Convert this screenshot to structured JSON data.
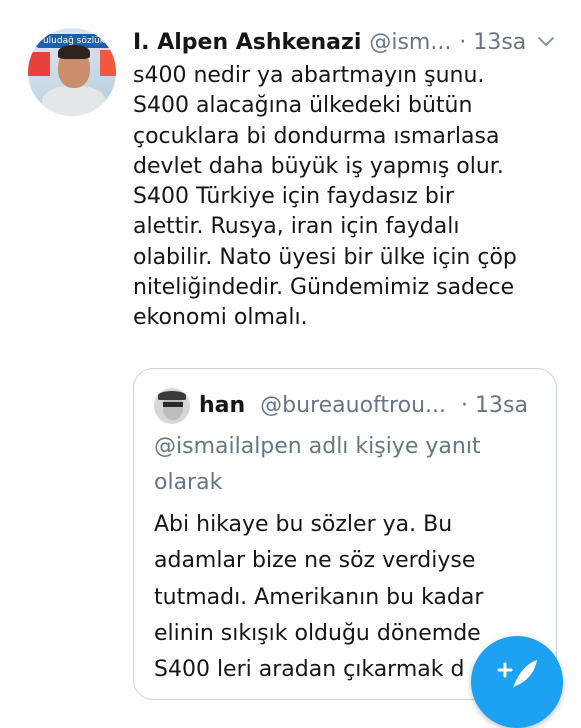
{
  "tweet": {
    "avatar_text": "uludağ sözlük",
    "name": "I. Alpen Ashkenazi",
    "handle": "@ism...",
    "time": "· 13sa",
    "lines": [
      "s400 nedir ya abartmayın şunu.",
      "S400 alacağına ülkedeki bütün",
      "çocuklara bi dondurma ısmarlasa",
      "devlet daha büyük iş yapmış olur.",
      "S400 Türkiye için faydasız bir",
      "alettir. Rusya, iran için faydalı",
      "olabilir. Nato üyesi bir ülke için çöp",
      "niteliğindedir. Gündemimiz sadece",
      "ekonomi olmalı."
    ]
  },
  "quoted_tweet": {
    "name": "han",
    "handle": "@bureauoftrou...",
    "time": "· 13sa",
    "reply_lines": [
      "@ismailalpen adlı kişiye yanıt",
      "olarak"
    ],
    "lines": [
      "Abi hikaye bu sözler ya. Bu",
      "adamlar bize ne söz verdiyse",
      "tutmadı. Amerikanın bu kadar",
      "elinin sıkışık olduğu dönemde",
      "S400 leri aradan çıkarmak d"
    ]
  },
  "icons": {
    "menu": "chevron-down-icon",
    "compose": "compose-tweet-icon"
  },
  "colors": {
    "accent": "#1da1f2",
    "secondary_text": "#657786",
    "border": "#ccd6dd"
  }
}
